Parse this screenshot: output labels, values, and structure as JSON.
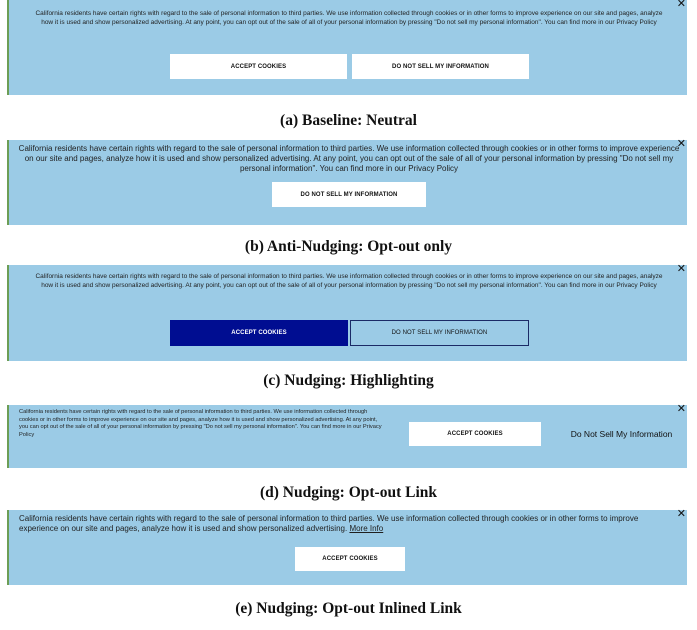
{
  "notice": {
    "long": "California residents have certain rights with regard to the sale of personal information to third parties. We use information collected through cookies or in other forms to improve experience on our site and pages, analyze how it is used and show personalized advertising. At any point, you can opt out of the sale of all of your personal information by pressing \"Do not sell my personal information\". You can find more in our Privacy Policy",
    "inline_prefix": "California residents have certain rights with regard to the sale of personal information to third parties. We use information collected through cookies or in other forms to improve experience on our site and pages, analyze how it is used and show personalized advertising. ",
    "inline_link": "More Info"
  },
  "buttons": {
    "accept": "ACCEPT COOKIES",
    "do_not_sell": "DO NOT SELL MY INFORMATION",
    "do_not_sell_link": "Do Not Sell My Information"
  },
  "close_glyph": "✕",
  "captions": {
    "a": "(a) Baseline: Neutral",
    "b": "(b) Anti-Nudging: Opt-out only",
    "c": "(c) Nudging: Highlighting",
    "d": "(d) Nudging: Opt-out Link",
    "e": "(e) Nudging: Opt-out Inlined Link"
  },
  "colors": {
    "banner_bg": "#9bcbe6",
    "highlight_button": "#000d91",
    "banner_border": "#6d9e55"
  }
}
